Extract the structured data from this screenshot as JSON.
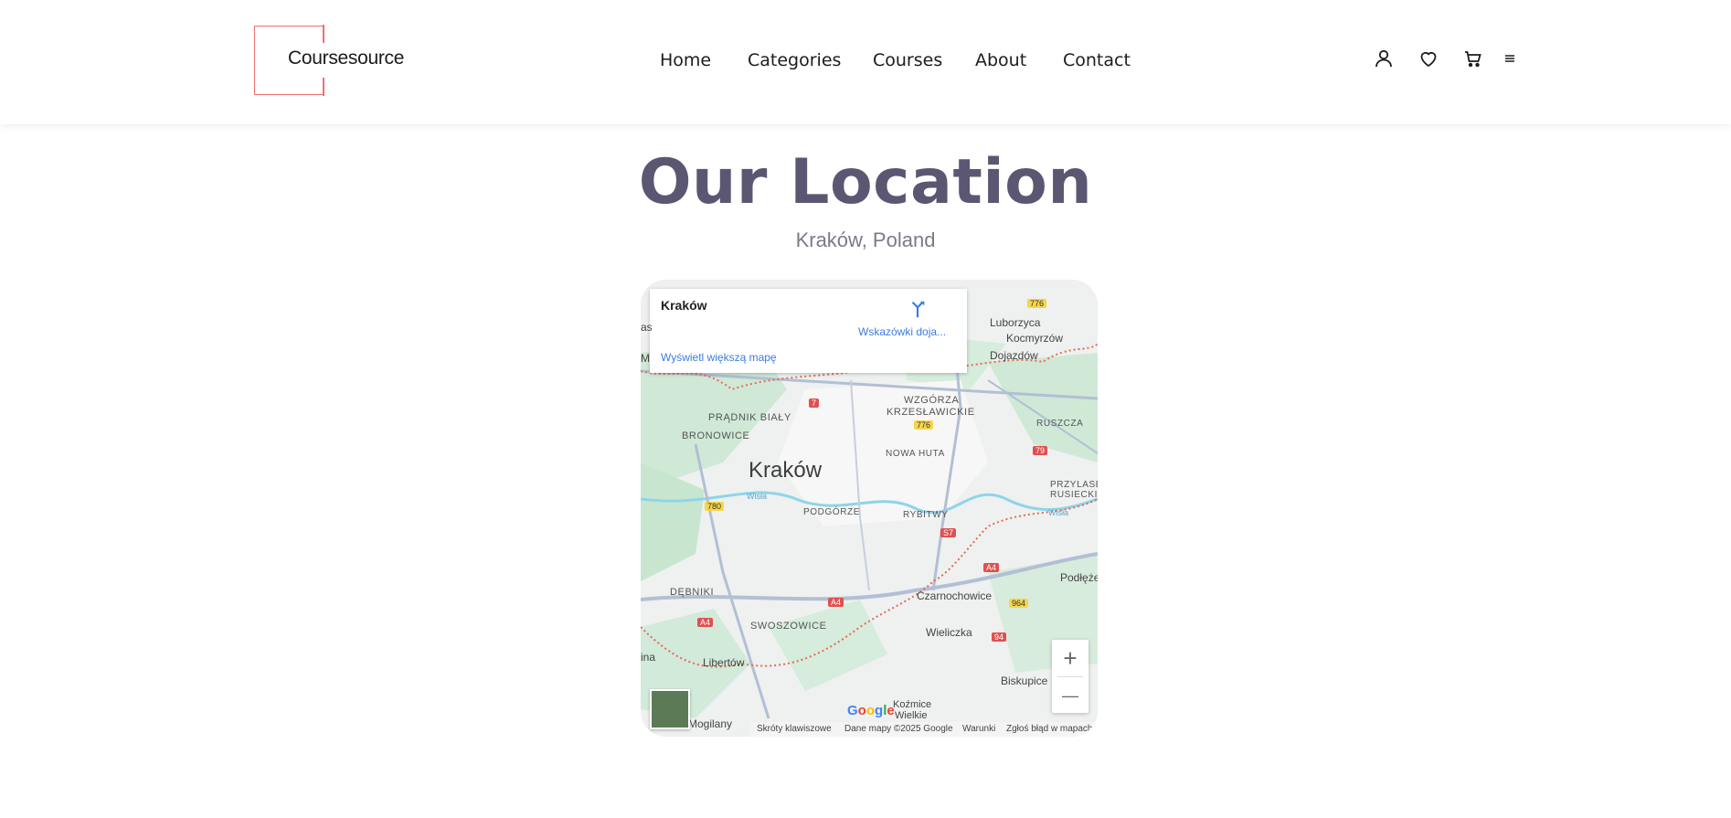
{
  "header": {
    "logo_text": "Coursesource",
    "nav": [
      "Home",
      "Categories",
      "Courses",
      "About",
      "Contact"
    ],
    "icons": [
      "user-icon",
      "heart-icon",
      "cart-icon",
      "menu-icon"
    ]
  },
  "hero": {
    "title": "Our Location",
    "subtitle": "Kraków, Poland"
  },
  "map": {
    "card_title": "Kraków",
    "directions": "Wskazówki doja...",
    "larger_map": "Wyświetl większą mapę",
    "city_label": "Kraków",
    "labels": {
      "pradnik": "PRĄDNIK BIAŁY",
      "bronowice": "BRONOWICE",
      "wzgorza": "WZGÓRZA",
      "krzeslawickie": "KRZESŁAWICKIE",
      "nowa_huta": "NOWA HUTA",
      "ruszcza": "RUSZCZA",
      "przylasek": "PRZYLASEK",
      "rusiecki": "RUSIECKI",
      "podgorze": "PODGÓRZE",
      "rybitwy": "RYBITWY",
      "debniki": "DĘBNIKI",
      "swoszowice": "SWOSZOWICE",
      "luborzyca": "Luborzyca",
      "kocmyrzow": "Kocmyrzów",
      "dojazdow": "Dojazdów",
      "podleze": "Podłęże",
      "czarnochowice": "Czarnochowice",
      "wieliczka": "Wieliczka",
      "libertow": "Libertów",
      "biskupice": "Biskupice",
      "kozmice": "Koźmice",
      "wielkie": "Wielkie",
      "mogilany": "Mogilany",
      "wisla": "Wisła",
      "wisla2": "Wisła",
      "edge_as": "as",
      "edge_m": "M",
      "edge_ina": "ina"
    },
    "roads": {
      "r776a": "776",
      "r776b": "776",
      "r7": "7",
      "r79": "79",
      "r780": "780",
      "rs7": "S7",
      "ra4a": "A4",
      "ra4b": "A4",
      "ra4c": "A4",
      "r964": "964",
      "r94": "94"
    },
    "zoom_in": "+",
    "zoom_out": "—",
    "google": "Google",
    "footer": {
      "shortcuts": "Skróty klawiszowe",
      "data": "Dane mapy ©2025 Google",
      "terms": "Warunki",
      "report": "Zgłoś błąd w mapach"
    }
  }
}
